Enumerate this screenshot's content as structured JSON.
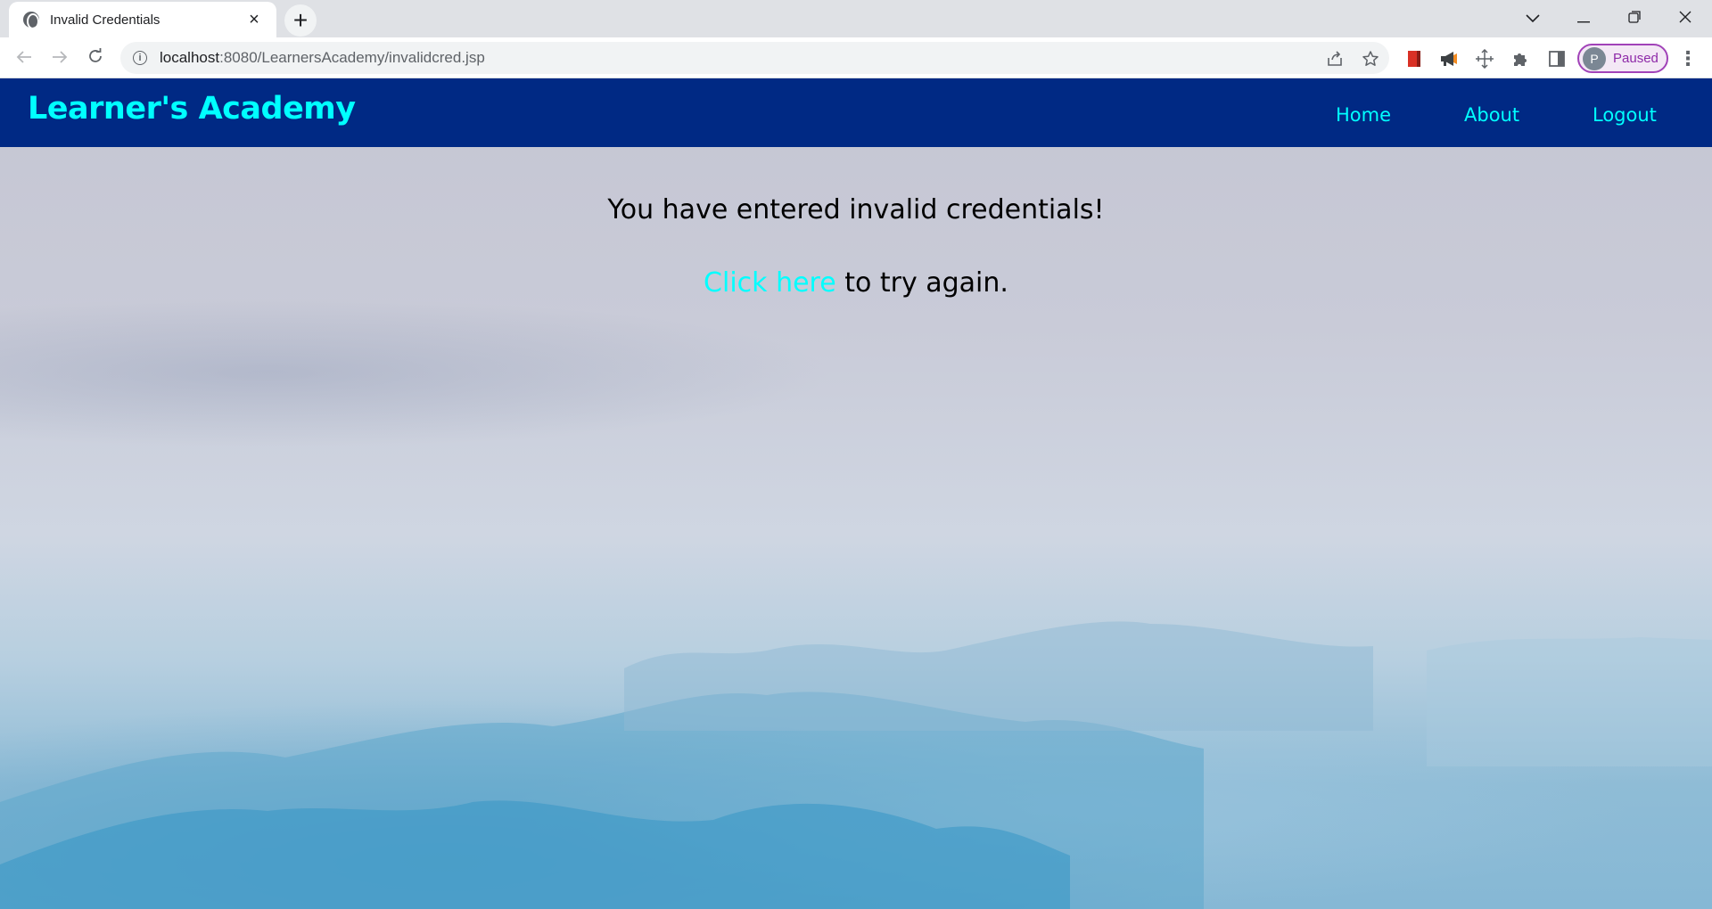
{
  "browser": {
    "tab": {
      "title": "Invalid Credentials",
      "close_icon": "close-icon",
      "favicon": "globe-icon"
    },
    "new_tab_icon": "plus-icon",
    "window_controls": {
      "dropdown": "chevron-down-icon",
      "minimize": "minimize-icon",
      "restore": "restore-icon",
      "close": "close-icon"
    },
    "address_bar": {
      "host": "localhost",
      "path": ":8080/LearnersAcademy/invalidcred.jsp"
    },
    "profile": {
      "initial": "P",
      "status": "Paused"
    },
    "accent_color": "#a142b8"
  },
  "site": {
    "brand": "Learner's Academy",
    "nav": [
      "Home",
      "About",
      "Logout"
    ],
    "header_color": "#002984",
    "link_color": "#00ffff"
  },
  "content": {
    "heading": "You have entered invalid credentials!",
    "link_text": "Click here",
    "after_link": " to try again."
  }
}
